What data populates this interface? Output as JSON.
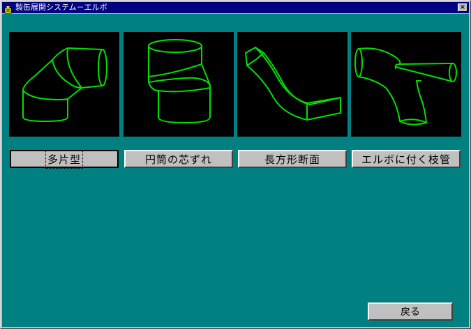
{
  "window": {
    "title": "製缶展開システム－エルボ",
    "close_label": "×"
  },
  "tiles": [
    {
      "label": "多片型",
      "icon": "multi-piece-elbow-icon"
    },
    {
      "label": "円筒の芯ずれ",
      "icon": "offset-cylinder-icon"
    },
    {
      "label": "長方形断面",
      "icon": "rectangular-duct-icon"
    },
    {
      "label": "エルボに付く枝管",
      "icon": "elbow-branch-pipe-icon"
    }
  ],
  "back_button": {
    "label": "戻る"
  },
  "colors": {
    "background": "#008080",
    "titlebar": "#000080",
    "wireframe": "#00e000",
    "tile": "#000000",
    "button": "#c0c0c0"
  }
}
